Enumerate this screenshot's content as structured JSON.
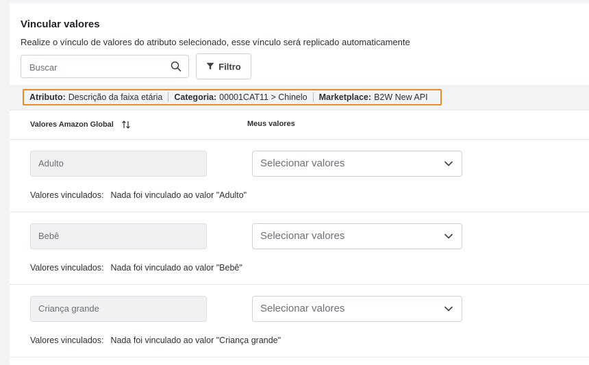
{
  "section": {
    "title": "Vincular valores",
    "subtitle": "Realize o vínculo de valores do atributo selecionado, esse vínculo será replicado automaticamente"
  },
  "search": {
    "placeholder": "Buscar",
    "icon": "search-icon"
  },
  "filter": {
    "label": "Filtro",
    "icon": "funnel-icon"
  },
  "info": {
    "attribute_label": "Atributo:",
    "attribute_value": "Descrição da faixa etária",
    "category_label": "Categoria:",
    "category_value": "00001CAT11 > Chinelo",
    "marketplace_label": "Marketplace:",
    "marketplace_value": "B2W New API",
    "highlight_color": "#f08a24"
  },
  "columns": {
    "amazon": "Valores Amazon Global",
    "mine": "Meus valores"
  },
  "rows": [
    {
      "value": "Adulto",
      "select_placeholder": "Selecionar valores",
      "linked_label": "Valores vinculados:",
      "linked_message": "Nada foi vinculado ao valor \"Adulto\""
    },
    {
      "value": "Bebê",
      "select_placeholder": "Selecionar valores",
      "linked_label": "Valores vinculados:",
      "linked_message": "Nada foi vinculado ao valor \"Bebê\""
    },
    {
      "value": "Criança grande",
      "select_placeholder": "Selecionar valores",
      "linked_label": "Valores vinculados:",
      "linked_message": "Nada foi vinculado ao valor \"Criança grande\""
    }
  ]
}
